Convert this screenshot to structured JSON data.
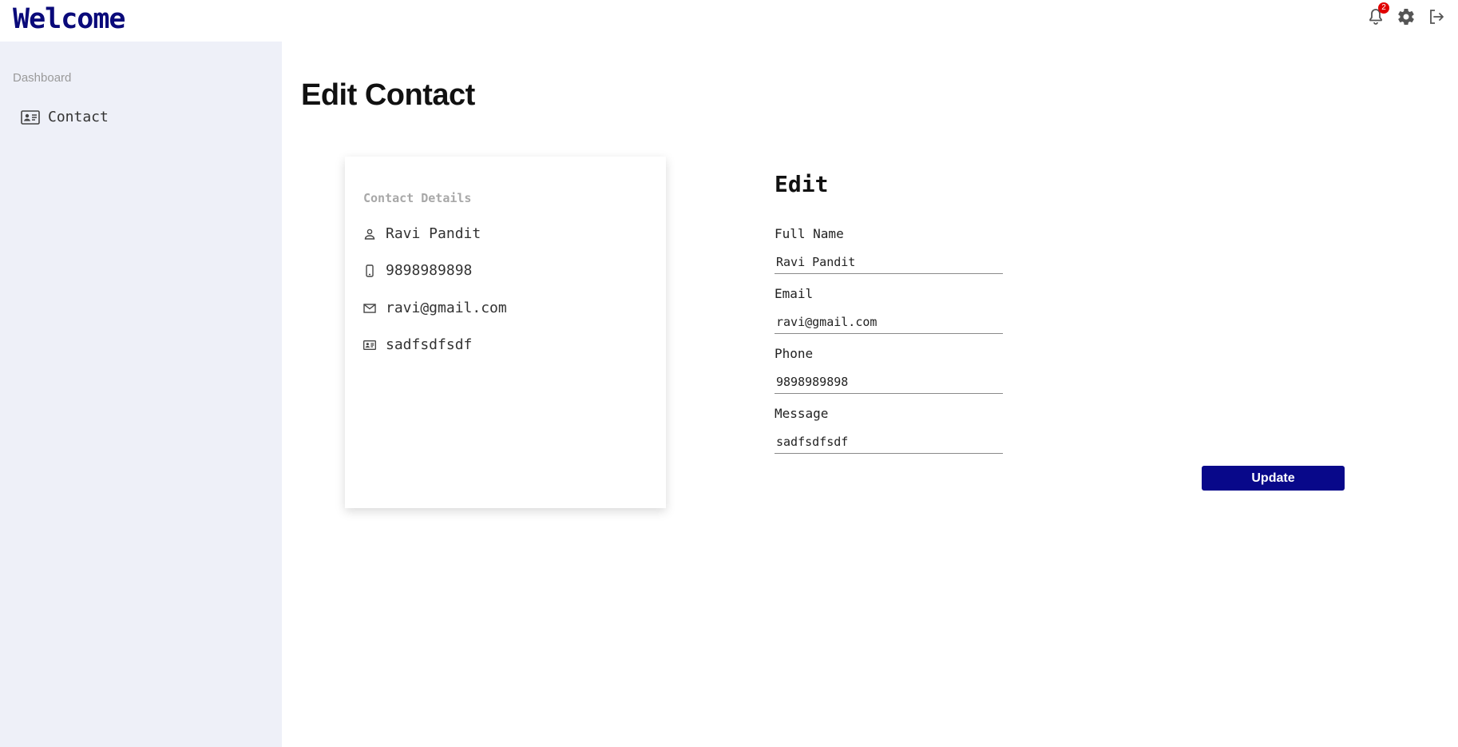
{
  "header": {
    "brand": "Welcome",
    "notification_count": "2",
    "icons": [
      "bell-icon",
      "gear-icon",
      "logout-icon"
    ]
  },
  "sidebar": {
    "heading": "Dashboard",
    "items": [
      {
        "label": "Contact",
        "icon": "contact-card-icon"
      }
    ]
  },
  "main": {
    "title": "Edit Contact"
  },
  "card": {
    "heading": "Contact Details",
    "details": [
      {
        "icon": "person-icon",
        "value": "Ravi Pandit"
      },
      {
        "icon": "phone-icon",
        "value": "9898989898"
      },
      {
        "icon": "mail-icon",
        "value": "ravi@gmail.com"
      },
      {
        "icon": "contact-card-icon",
        "value": "sadfsdfsdf"
      }
    ]
  },
  "form": {
    "title": "Edit",
    "full_name_label": "Full Name",
    "full_name_value": "Ravi Pandit",
    "email_label": "Email",
    "email_value": "ravi@gmail.com",
    "phone_label": "Phone",
    "phone_value": "9898989898",
    "message_label": "Message",
    "message_value": "sadfsdfsdf",
    "update_label": "Update"
  },
  "colors": {
    "brand": "#0a0a7a",
    "sidebar_bg": "#eef0f8",
    "button_bg": "#08088a",
    "badge": "#e00000"
  }
}
